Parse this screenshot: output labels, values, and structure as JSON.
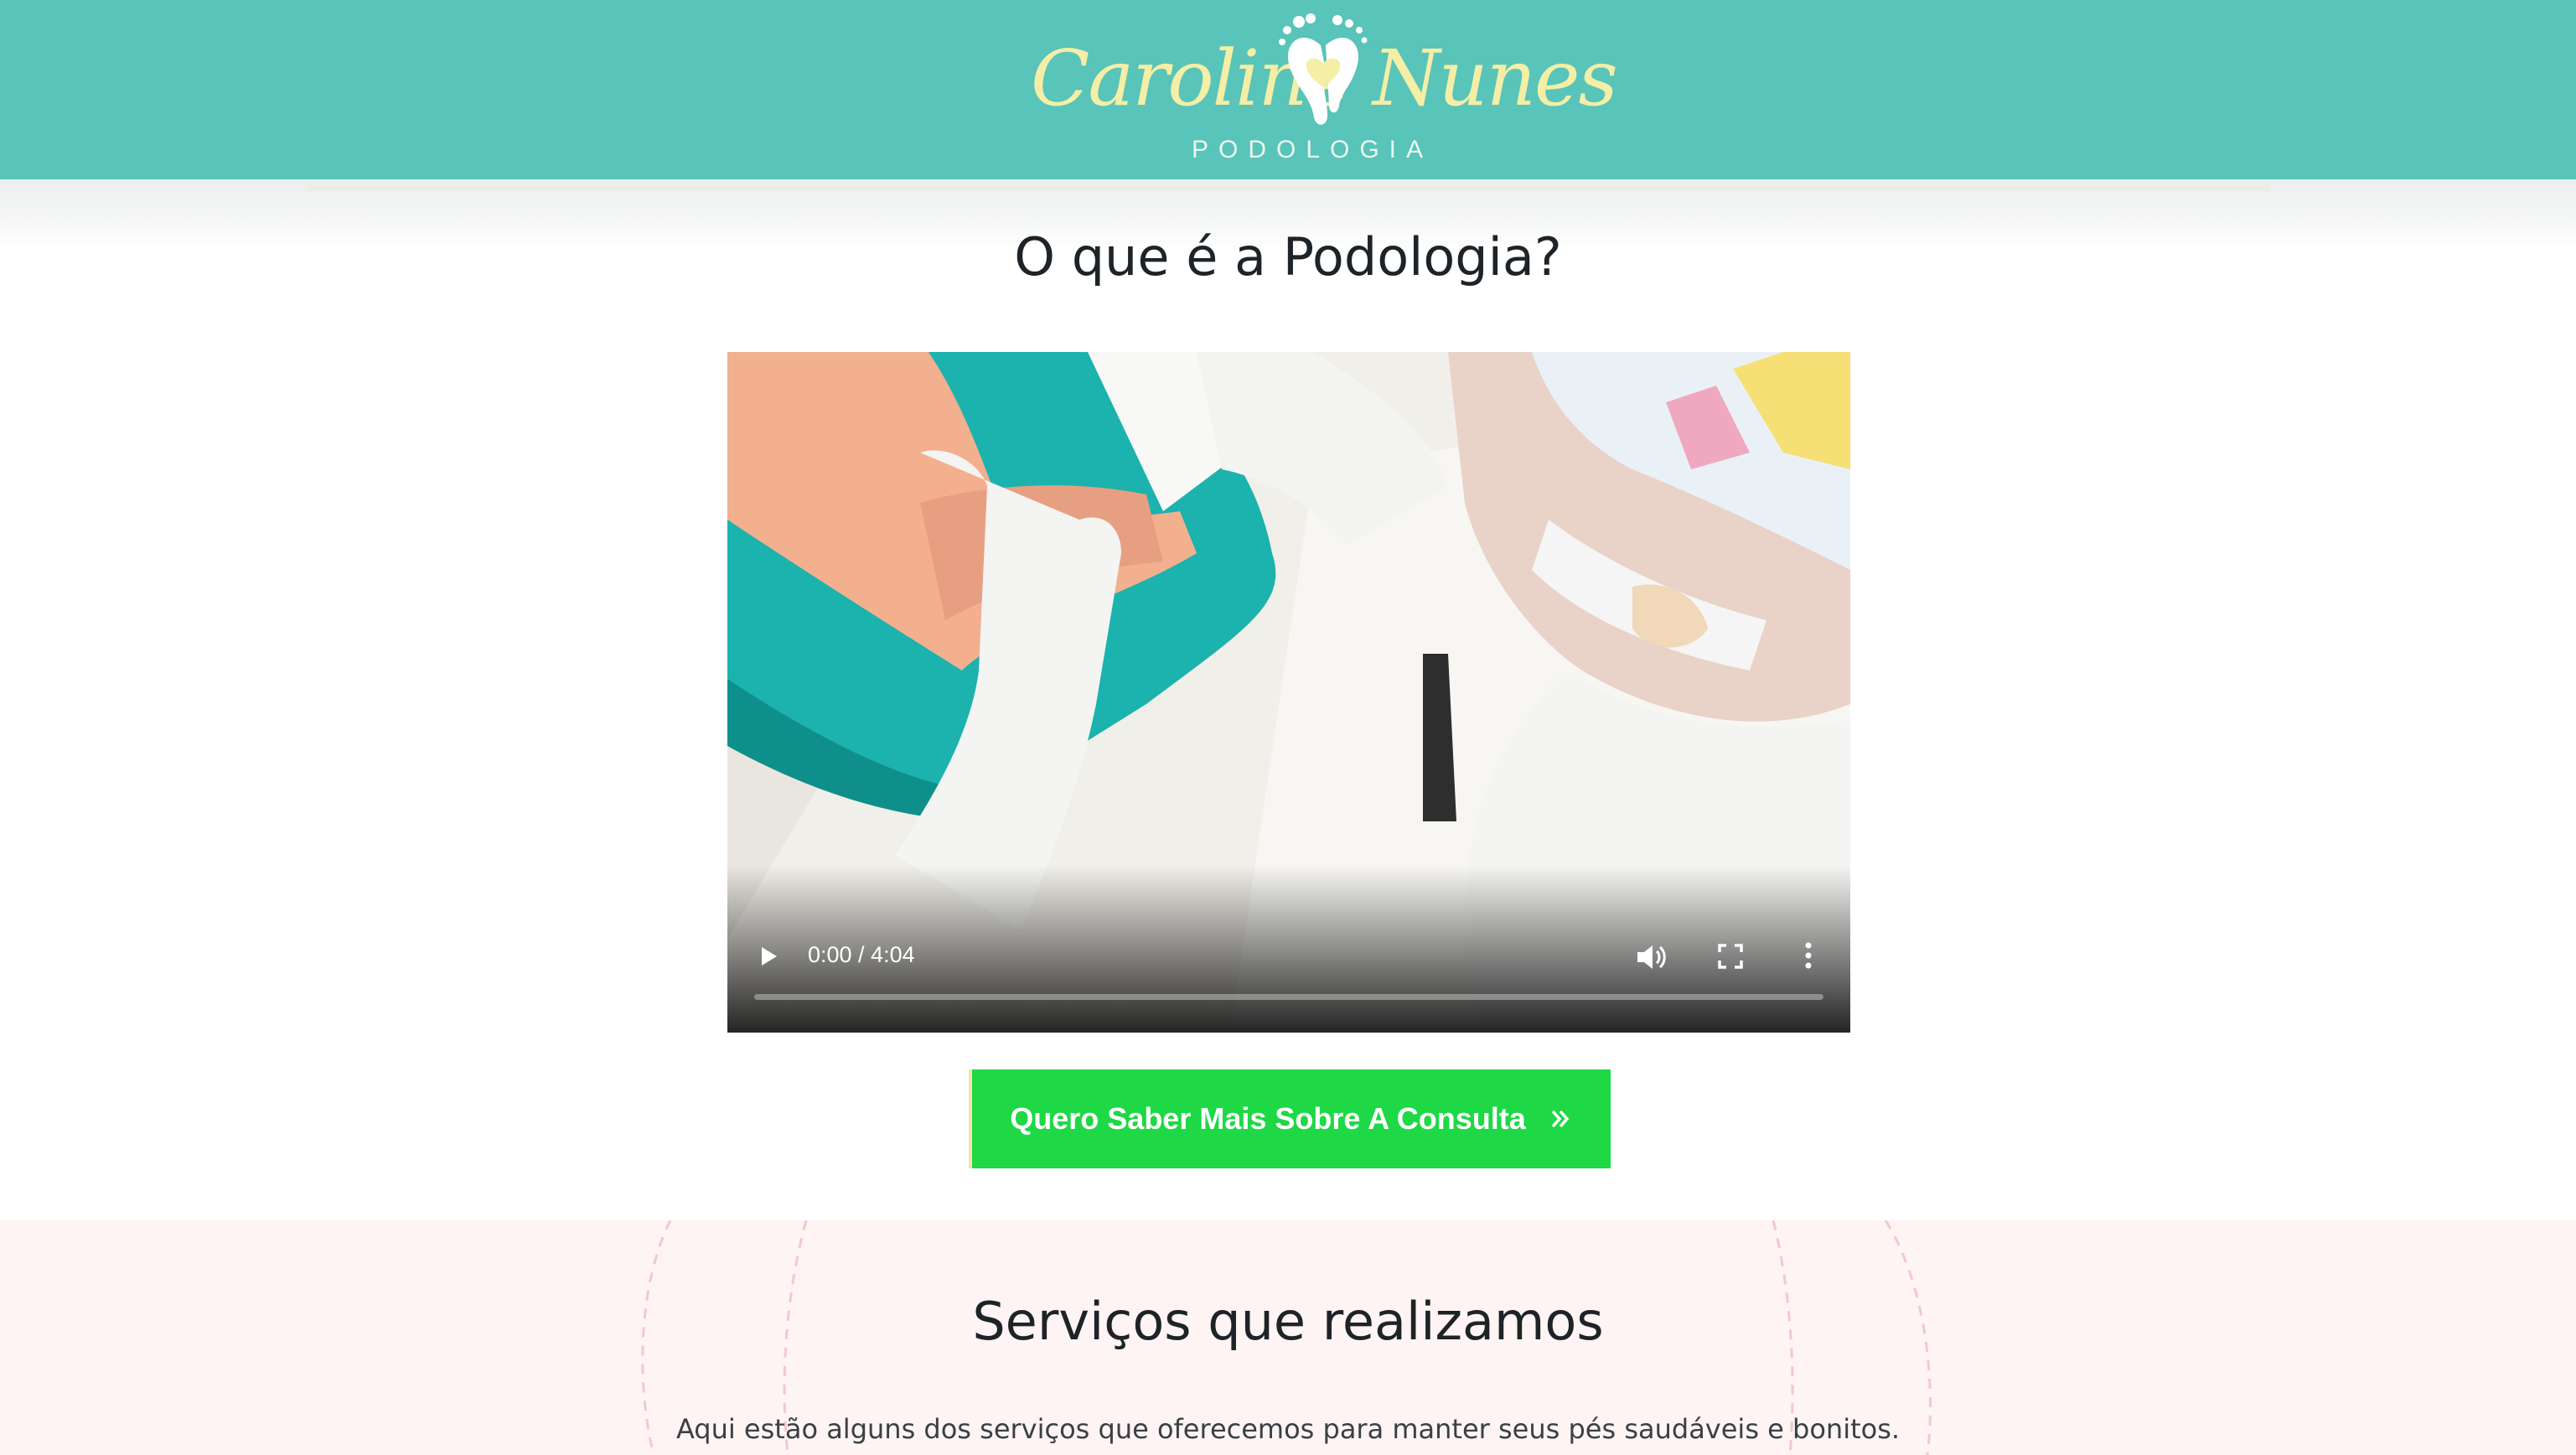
{
  "header": {
    "logo_first": "Caroline",
    "logo_last": "Nunes",
    "logo_tagline": "PODOLOGIA",
    "logo_mark_icon": "feet-heart-icon",
    "background_color": "#59c4b9",
    "accent_color": "#f6e3a8"
  },
  "section_video": {
    "title": "O que é a Podologia?",
    "video": {
      "time_display": "0:00 / 4:04",
      "progress": 0,
      "icons": [
        "play-icon",
        "volume-icon",
        "fullscreen-icon",
        "more-options-icon"
      ]
    },
    "cta_label": "Quero Saber Mais Sobre A Consulta",
    "cta_icon": "double-chevron-right-icon",
    "cta_color": "#1fd846"
  },
  "section_services": {
    "title": "Serviços que realizamos",
    "description": "Aqui estão alguns dos serviços que oferecemos para manter seus pés saudáveis e bonitos.",
    "background_color": "#fdf4f3"
  }
}
